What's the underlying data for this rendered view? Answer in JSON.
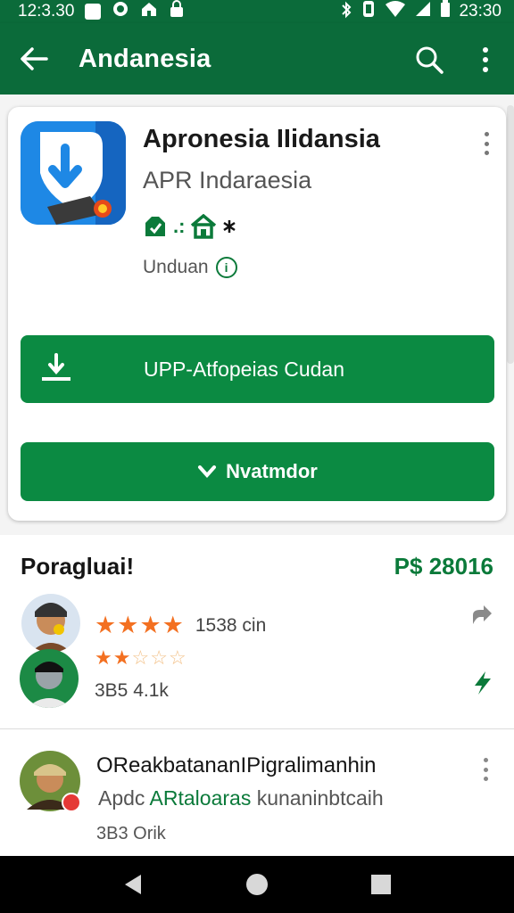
{
  "status_bar": {
    "time_left": "12:3.30",
    "time_right": "23:30",
    "icons_left": [
      "image-icon",
      "whatsapp-icon",
      "home-icon",
      "lock-icon"
    ],
    "icons_right": [
      "bluetooth-icon",
      "vibrate-icon",
      "wifi-icon",
      "signal-icon",
      "battery-icon"
    ]
  },
  "app_bar": {
    "title": "Andanesia"
  },
  "app_card": {
    "title": "Apronesia IIidansia",
    "subtitle": "APR Indaraesia",
    "badge_text": ".:",
    "downloads_label": "Unduan",
    "info_symbol": "i",
    "install_label": "UPP-Atfopeias Cudan",
    "secondary_label": "Nvatmdor",
    "icon_color": "#1e88e5"
  },
  "section": {
    "title": "Poragluai!",
    "price": "P$ 28016"
  },
  "review": {
    "rating_1_full": 4,
    "rating_1_count": "1538 cin",
    "rating_2_full": 2,
    "rating_2_total": 5,
    "size": "3B5 4.1k"
  },
  "list_item": {
    "title": "OReakbatananIPigralimanhin",
    "subtitle_prefix": "Apdc ",
    "subtitle_accent": "ARtaloaras",
    "subtitle_rest": " kunaninbtcaih",
    "meta": "3B3 Orik"
  },
  "colors": {
    "primary_green": "#0b6b3a",
    "button_green": "#0b8a42",
    "star_orange": "#f37021"
  }
}
